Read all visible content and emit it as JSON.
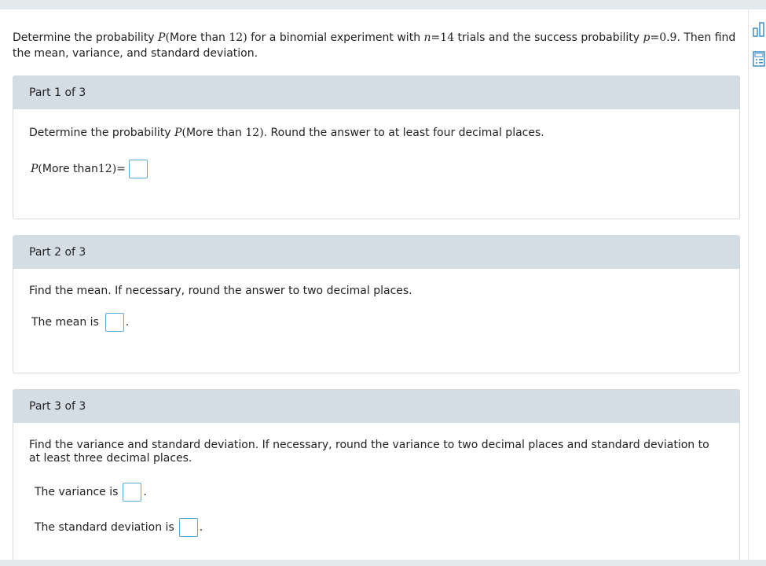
{
  "question": {
    "prefix": "Determine the probability ",
    "p_symbol": "P",
    "event_inner_text": "More than ",
    "event_number": "12",
    "middle": " for a binomial experiment with ",
    "n_symbol": "n",
    "eq": "=",
    "n_value": "14",
    "middle2": " trials and the success probability ",
    "p_var": "p",
    "p_value": "0.9",
    "suffix": ". Then find the mean, variance, and standard deviation."
  },
  "parts": [
    {
      "header": "Part 1 of 3",
      "instruction_prefix": "Determine the probability ",
      "instruction_suffix": ". Round the answer to at least four decimal places.",
      "answer_label_inner": "More than ",
      "answer_number": "12",
      "answer_eq": "="
    },
    {
      "header": "Part 2 of 3",
      "instruction": "Find the mean. If necessary, round the answer to two decimal places.",
      "answer_label": "The mean is"
    },
    {
      "header": "Part 3 of 3",
      "instruction": "Find the variance and standard deviation. If necessary, round the variance to two decimal places and standard deviation to at least three decimal places.",
      "variance_label": "The variance is",
      "sd_label": "The standard deviation is"
    }
  ],
  "tools": [
    "bar-chart-icon",
    "calculator-icon"
  ],
  "accent_color": "#5aa7d6",
  "header_color": "#d3dde3"
}
